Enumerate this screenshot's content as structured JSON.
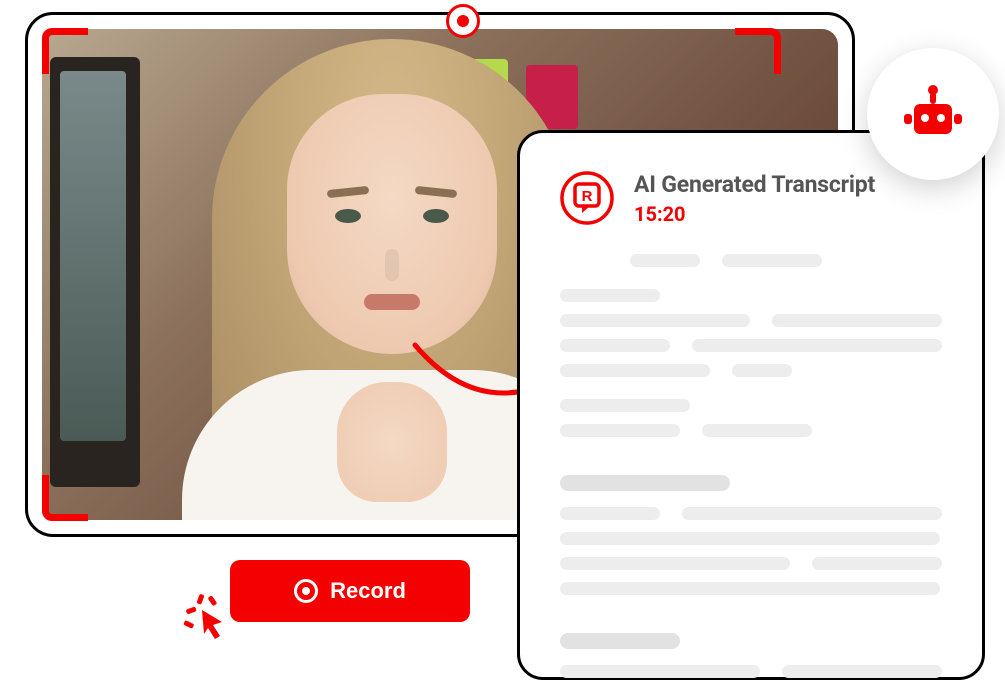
{
  "colors": {
    "accent": "#f40000",
    "text_muted": "#555555",
    "placeholder": "#ededed"
  },
  "record_button": {
    "label": "Record"
  },
  "transcript": {
    "title": "AI Generated Transcript",
    "timestamp": "15:20"
  },
  "icons": {
    "record_top": "record-dot-icon",
    "record_button": "record-icon",
    "cursor": "click-cursor-icon",
    "arrow": "arrow-right-icon",
    "app_logo": "r-speech-bubble-logo",
    "bot": "robot-icon"
  }
}
